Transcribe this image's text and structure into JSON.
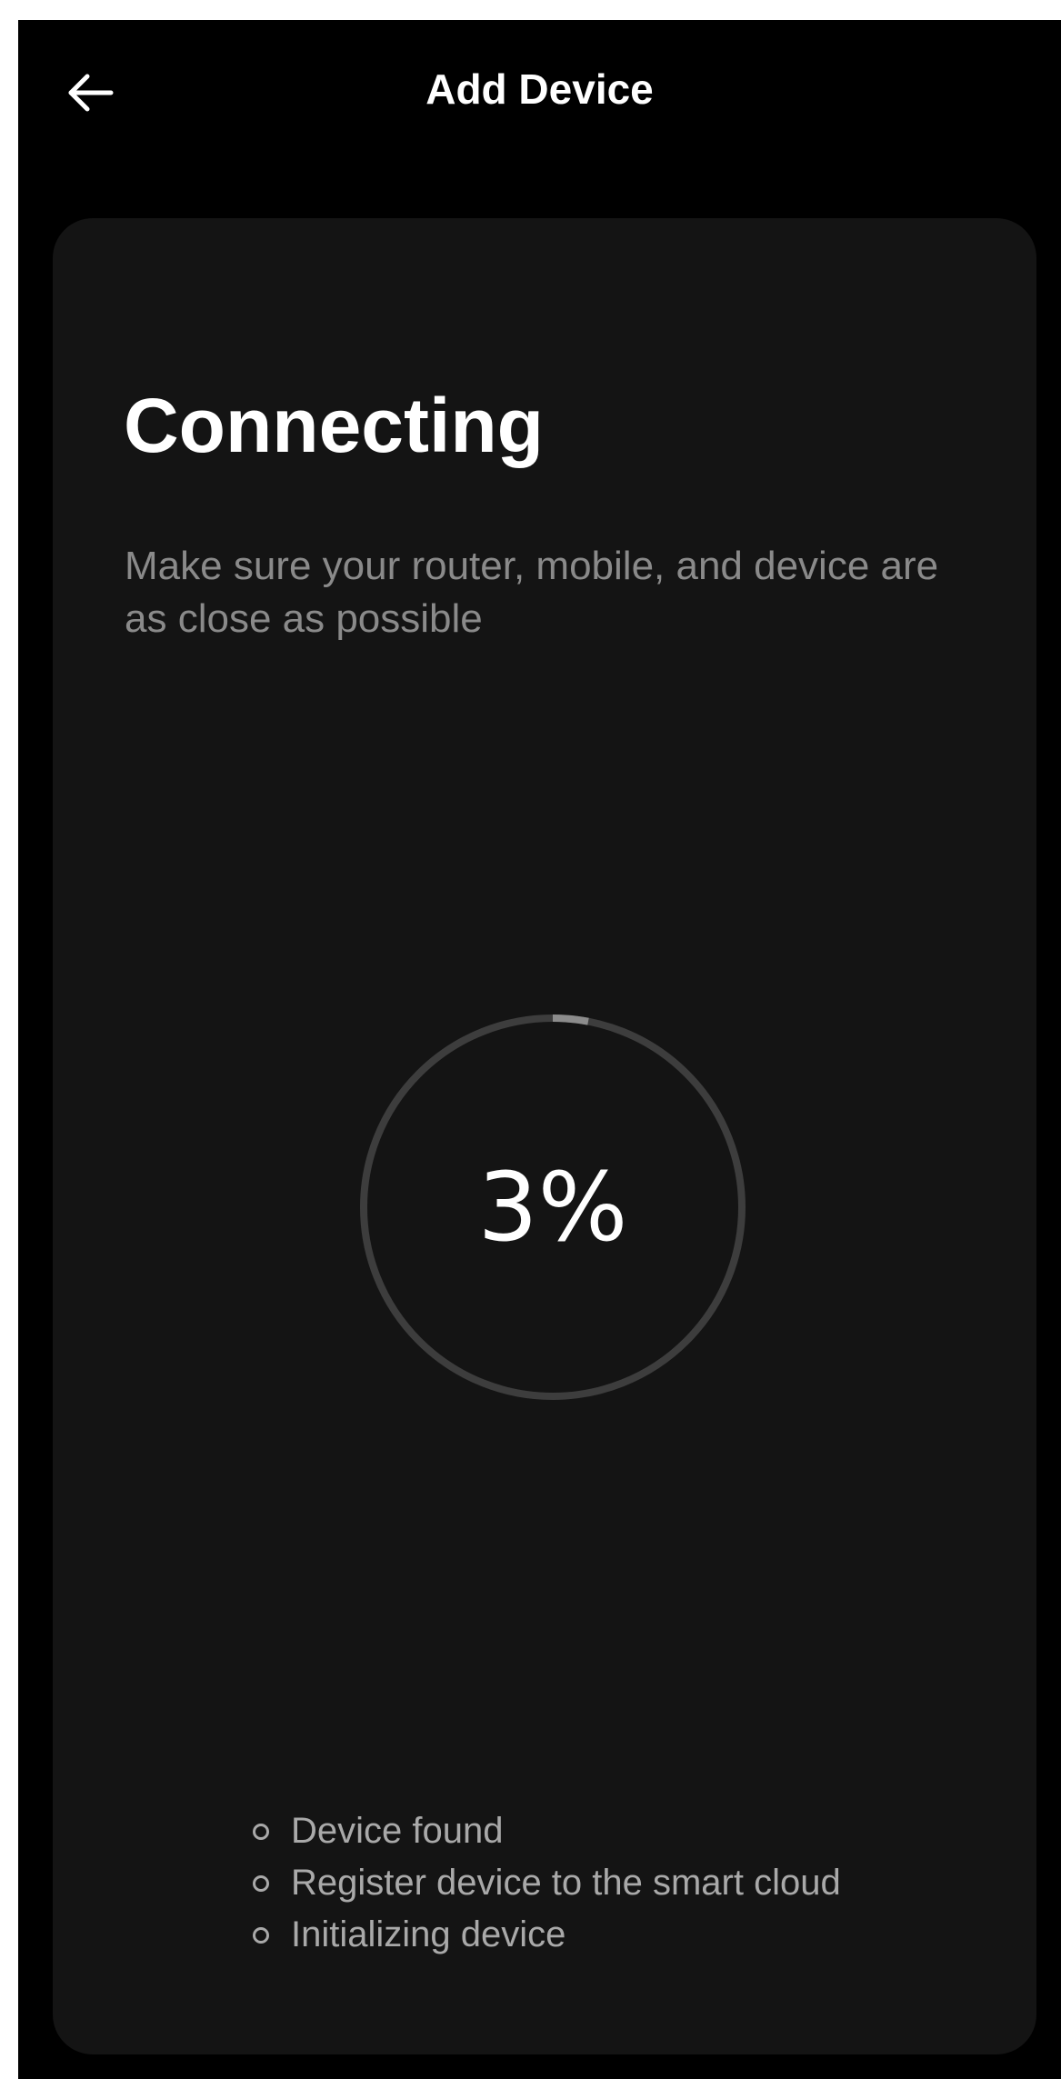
{
  "app_bar": {
    "title": "Add Device",
    "back_icon": "arrow-left-icon"
  },
  "card": {
    "heading": "Connecting",
    "subtitle": "Make sure your router, mobile, and device are as close as possible"
  },
  "progress": {
    "value": 3,
    "label": "3%",
    "track_color": "#3d3d3d",
    "fill_color": "#8c8c8c"
  },
  "steps": [
    {
      "label": "Device found"
    },
    {
      "label": "Register device to the smart cloud"
    },
    {
      "label": "Initializing device"
    }
  ],
  "colors": {
    "background": "#000000",
    "card": "#141414",
    "text_primary": "#ffffff",
    "text_secondary": "#8a8a8a"
  }
}
